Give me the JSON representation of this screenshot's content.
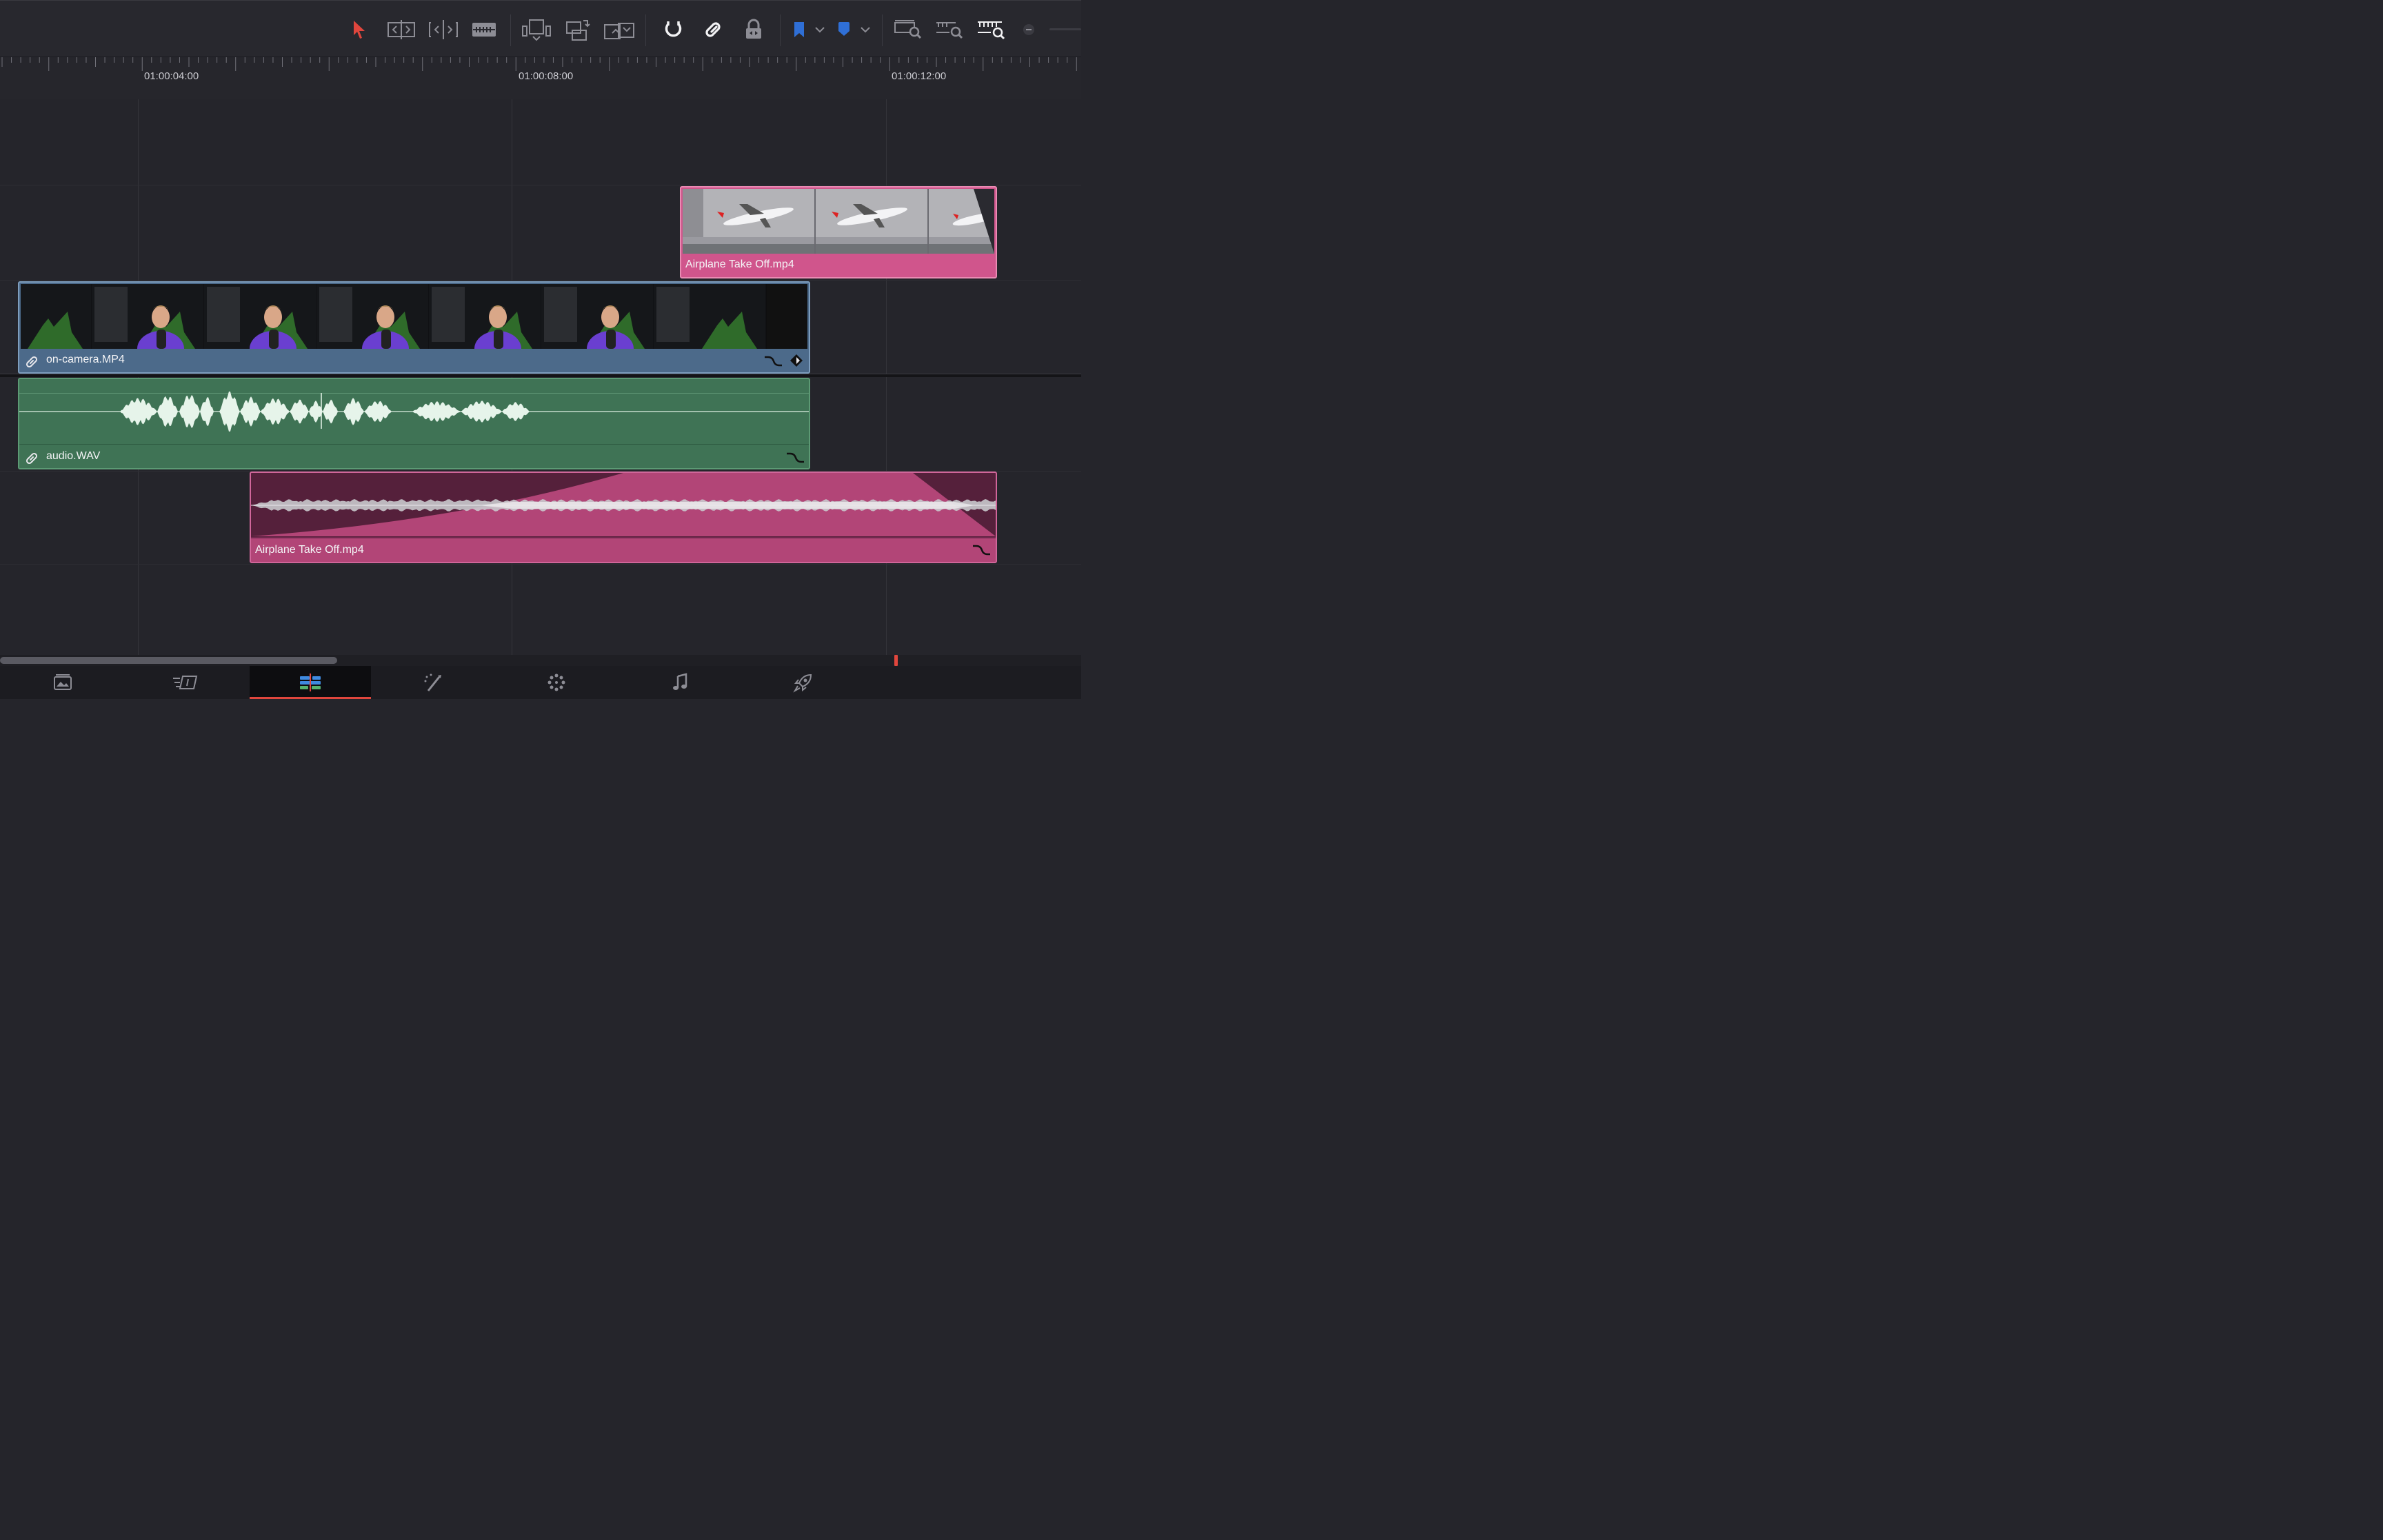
{
  "toolbar": {
    "tools": [
      {
        "name": "selection-mode-icon"
      },
      {
        "name": "trim-edit-mode-icon"
      },
      {
        "name": "dynamic-trim-mode-icon"
      },
      {
        "name": "blade-edit-mode-icon"
      },
      {
        "name": "insert-clip-icon"
      },
      {
        "name": "overwrite-clip-icon"
      },
      {
        "name": "replace-clip-icon"
      },
      {
        "name": "snapping-icon"
      },
      {
        "name": "linked-selection-icon"
      },
      {
        "name": "position-lock-icon"
      },
      {
        "name": "flag-icon"
      },
      {
        "name": "marker-icon"
      },
      {
        "name": "full-extent-zoom-icon"
      },
      {
        "name": "detail-zoom-icon"
      },
      {
        "name": "custom-zoom-icon"
      },
      {
        "name": "zoom-out-icon"
      }
    ],
    "accent_color": "#e0463d",
    "flag_color": "#2f6fd6",
    "marker_color": "#2f6fd6"
  },
  "ruler": {
    "timecodes": [
      "01:00:04:00",
      "01:00:08:00",
      "01:00:12:00"
    ]
  },
  "clips": {
    "video_b_roll": {
      "label": "Airplane Take Off.mp4",
      "color": "#d0558c"
    },
    "video_main": {
      "label": "on-camera.MP4",
      "color": "#4c6a8a"
    },
    "audio_main": {
      "label": "audio.WAV",
      "color": "#3f7355"
    },
    "audio_b_roll": {
      "label": "Airplane Take Off.mp4",
      "color": "#b24577"
    }
  },
  "pages": [
    {
      "name": "media-page-icon"
    },
    {
      "name": "cut-page-icon"
    },
    {
      "name": "edit-page-icon",
      "active": true
    },
    {
      "name": "fusion-page-icon"
    },
    {
      "name": "color-page-icon"
    },
    {
      "name": "fairlight-page-icon"
    },
    {
      "name": "deliver-page-icon"
    }
  ]
}
